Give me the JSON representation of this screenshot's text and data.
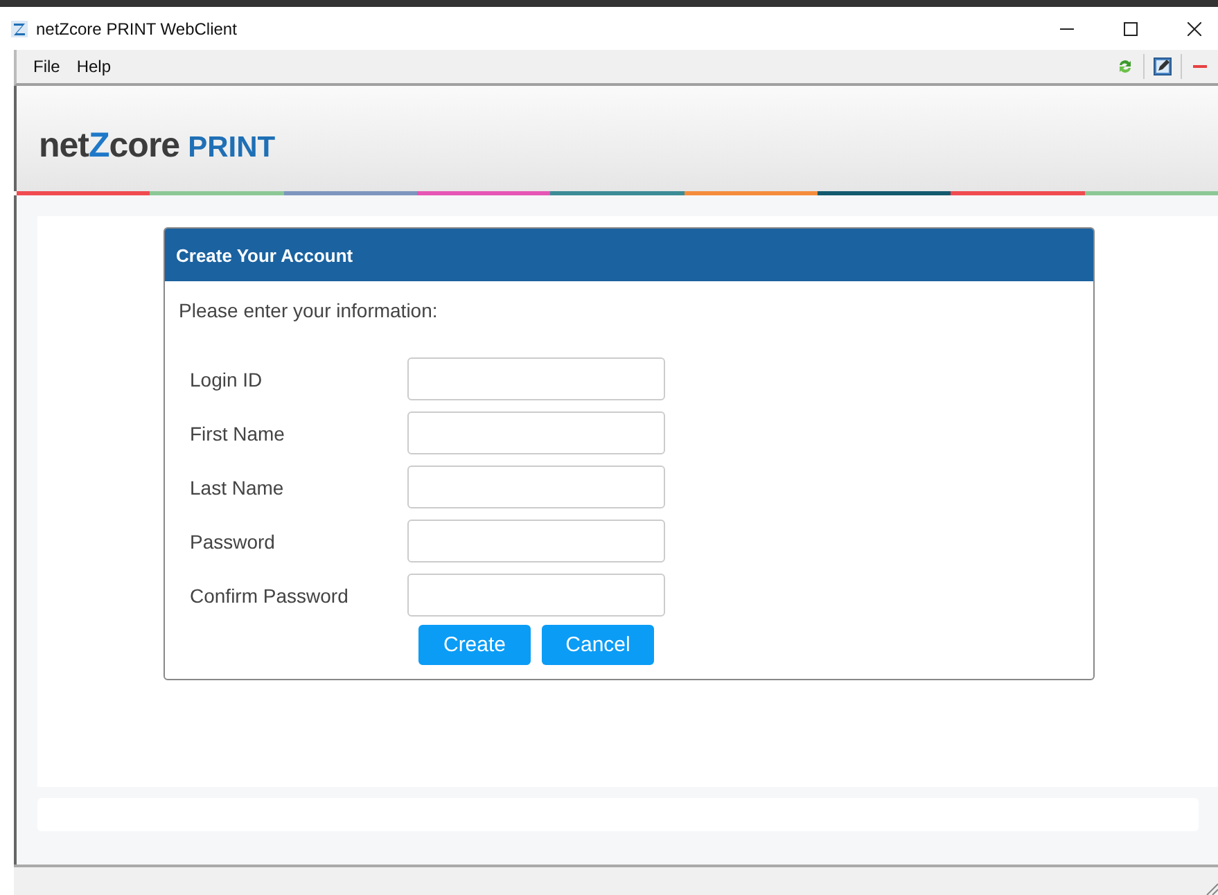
{
  "window": {
    "title": "netZcore PRINT WebClient"
  },
  "menu": [
    "File",
    "Help"
  ],
  "logo": {
    "before": "net",
    "mark": "Z",
    "after": "core",
    "product": "PRINT"
  },
  "strip": [
    {
      "color": "#ef4b50"
    },
    {
      "color": "#8cc896"
    },
    {
      "color": "#7d96be"
    },
    {
      "color": "#e656b4"
    },
    {
      "color": "#3c8c96"
    },
    {
      "color": "#f58c3c"
    },
    {
      "color": "#145a6e"
    },
    {
      "color": "#ef4b50"
    },
    {
      "color": "#8cc896"
    }
  ],
  "form": {
    "title": "Create Your Account",
    "intro": "Please enter your information:",
    "fields": [
      {
        "label": "Login ID"
      },
      {
        "label": "First Name"
      },
      {
        "label": "Last Name"
      },
      {
        "label": "Password"
      },
      {
        "label": "Confirm Password"
      }
    ],
    "buttons": [
      "Create",
      "Cancel"
    ]
  }
}
